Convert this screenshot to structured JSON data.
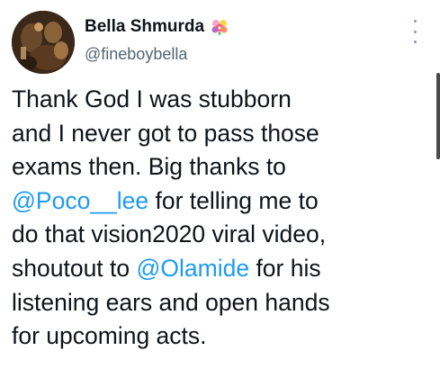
{
  "author": {
    "display_name": "Bella Shmurda",
    "badge_icon": "flower-bouquet-icon",
    "handle": "@fineboybella"
  },
  "menu": {
    "icon": "more-vertical-icon"
  },
  "colors": {
    "text": "#0f1419",
    "secondary": "#536471",
    "link": "#1d9bf0"
  },
  "tweet": {
    "lines": [
      [
        "Thank God I was stubborn"
      ],
      [
        "and I never got to pass those"
      ],
      [
        "exams then. Big thanks to"
      ],
      [
        "@Poco__lee",
        " for telling me to"
      ],
      [
        "do that vision2020 viral video,"
      ],
      [
        "shoutout to ",
        "@Olamide",
        " for his"
      ],
      [
        "listening ears and open hands"
      ],
      [
        "for upcoming acts."
      ]
    ],
    "mentions": [
      "@Poco__lee",
      "@Olamide"
    ]
  }
}
